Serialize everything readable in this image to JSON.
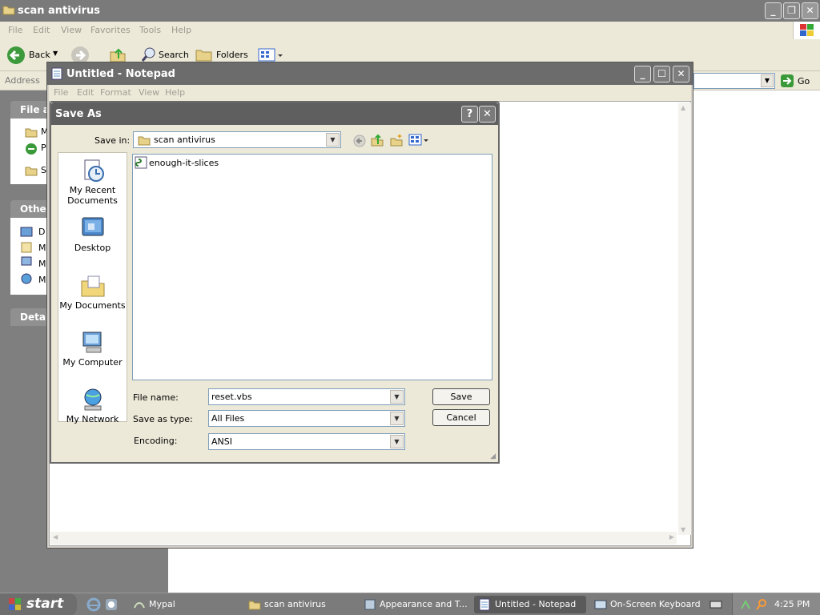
{
  "explorer": {
    "title": "scan antivirus",
    "menu": [
      "File",
      "Edit",
      "View",
      "Favorites",
      "Tools",
      "Help"
    ],
    "toolbar": {
      "back": "Back",
      "search": "Search",
      "folders": "Folders"
    },
    "address_label": "Address",
    "go_label": "Go",
    "panels": {
      "file_tasks": "File ar",
      "other": "Other",
      "details": "Detail"
    },
    "file_task_items": [
      "M",
      "P",
      "S"
    ],
    "other_items": [
      "D",
      "M",
      "M",
      "M"
    ]
  },
  "notepad": {
    "title": "Untitled - Notepad",
    "menu": [
      "File",
      "Edit",
      "Format",
      "View",
      "Help"
    ]
  },
  "saveas": {
    "title": "Save As",
    "save_in_label": "Save in:",
    "save_in_value": "scan antivirus",
    "places": [
      "My Recent Documents",
      "Desktop",
      "My Documents",
      "My Computer",
      "My Network"
    ],
    "files": [
      "enough-it-slices"
    ],
    "file_name_label": "File name:",
    "file_name_value": "reset.vbs",
    "save_type_label": "Save as type:",
    "save_type_value": "All Files",
    "encoding_label": "Encoding:",
    "encoding_value": "ANSI",
    "save_button": "Save",
    "cancel_button": "Cancel"
  },
  "taskbar": {
    "start": "start",
    "items": [
      "Mypal",
      "scan antivirus",
      "Appearance and T...",
      "Untitled - Notepad",
      "On-Screen Keyboard"
    ],
    "clock": "4:25 PM"
  }
}
